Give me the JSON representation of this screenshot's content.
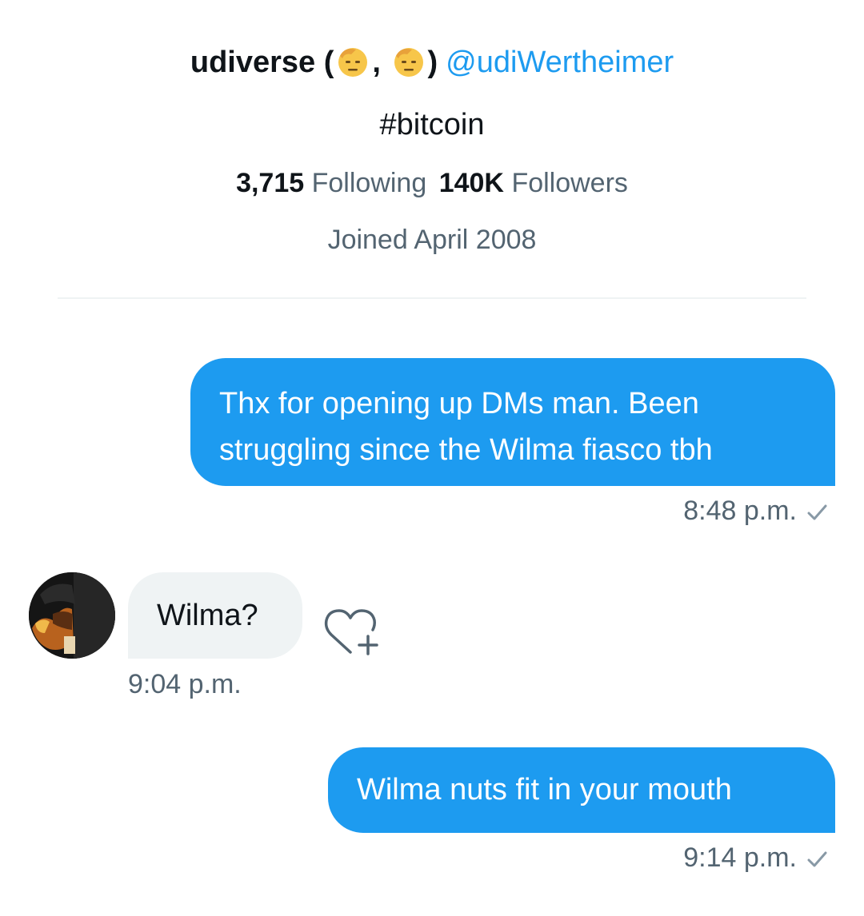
{
  "profile": {
    "name": "udiverse (",
    "name_sep": ",",
    "name_end": ")",
    "handle": "@udiWertheimer",
    "bio": "#bitcoin",
    "following_count": "3,715",
    "following_label": "Following",
    "followers_count": "140K",
    "followers_label": "Followers",
    "joined": "Joined April 2008"
  },
  "messages": [
    {
      "direction": "outgoing",
      "lines": [
        "Thx for opening up DMs man. Been",
        "struggling since the Wilma fiasco tbh"
      ],
      "time": "8:48 p.m."
    },
    {
      "direction": "incoming",
      "text": "Wilma?",
      "time": "9:04 p.m."
    },
    {
      "direction": "outgoing",
      "text": "Wilma nuts fit in your mouth",
      "time": "9:14 p.m."
    }
  ],
  "colors": {
    "accent": "#1d9bf0",
    "incoming_bubble": "#eff3f4",
    "secondary_text": "#536471"
  },
  "icons": [
    "saluting-face-emoji",
    "read-check-icon",
    "heart-plus-icon",
    "avatar"
  ]
}
